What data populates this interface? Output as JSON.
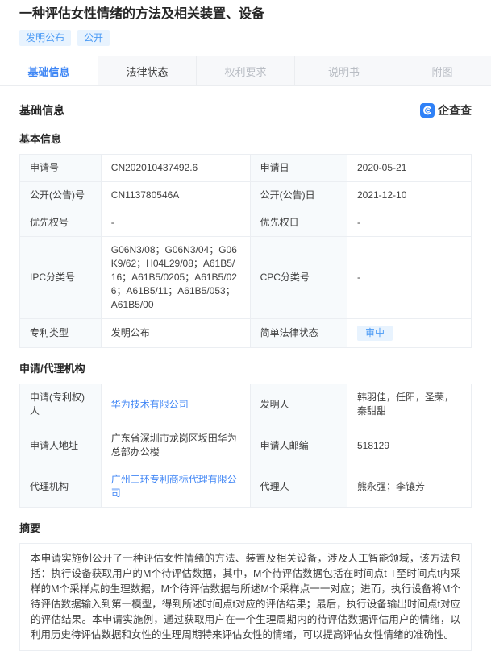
{
  "header": {
    "title": "一种评估女性情绪的方法及相关装置、设备",
    "badges": [
      "发明公布",
      "公开"
    ]
  },
  "tabs": [
    {
      "label": "基础信息",
      "state": "active"
    },
    {
      "label": "法律状态",
      "state": "enabled"
    },
    {
      "label": "权利要求",
      "state": "disabled"
    },
    {
      "label": "说明书",
      "state": "disabled"
    },
    {
      "label": "附图",
      "state": "disabled"
    }
  ],
  "section": {
    "title": "基础信息",
    "brand_name": "企查查"
  },
  "basic_info": {
    "title": "基本信息",
    "rows": [
      {
        "l1": "申请号",
        "v1": "CN202010437492.6",
        "l2": "申请日",
        "v2": "2020-05-21"
      },
      {
        "l1": "公开(公告)号",
        "v1": "CN113780546A",
        "l2": "公开(公告)日",
        "v2": "2021-12-10"
      },
      {
        "l1": "优先权号",
        "v1": "-",
        "l2": "优先权日",
        "v2": "-"
      },
      {
        "l1": "IPC分类号",
        "v1": "G06N3/08；G06N3/04；G06K9/62；H04L29/08；A61B5/16；A61B5/0205；A61B5/026；A61B5/11；A61B5/053；A61B5/00",
        "l2": "CPC分类号",
        "v2": "-"
      },
      {
        "l1": "专利类型",
        "v1": "发明公布",
        "l2": "简单法律状态",
        "v2": "审中"
      }
    ]
  },
  "agency_info": {
    "title": "申请/代理机构",
    "rows": [
      {
        "l1": "申请(专利权)人",
        "v1": "华为技术有限公司",
        "l2": "发明人",
        "v2": "韩羽佳，任阳，圣荣，秦甜甜"
      },
      {
        "l1": "申请人地址",
        "v1": "广东省深圳市龙岗区坂田华为总部办公楼",
        "l2": "申请人邮编",
        "v2": "518129"
      },
      {
        "l1": "代理机构",
        "v1": "广州三环专利商标代理有限公司",
        "l2": "代理人",
        "v2": "熊永强；李镶芳"
      }
    ]
  },
  "abstract": {
    "title": "摘要",
    "text": "本申请实施例公开了一种评估女性情绪的方法、装置及相关设备，涉及人工智能领域，该方法包括：执行设备获取用户的M个待评估数据，其中，M个待评估数据包括在时间点t-T至时间点t内采样的M个采样点的生理数据，M个待评估数据与所述M个采样点一一对应；进而，执行设备将M个待评估数据输入到第一模型，得到所述时间点t对应的评估结果；最后，执行设备输出时间点t对应的评估结果。本申请实施例，通过获取用户在一个生理周期内的待评估数据评估用户的情绪，以利用历史待评估数据和女性的生理周期特来评估女性的情绪，可以提高评估女性情绪的准确性。"
  },
  "colors": {
    "accent": "#3e86f5",
    "badge_bg": "#e8f3fe",
    "badge_text": "#4c9bf5",
    "logo_blue": "#2f81f7"
  }
}
